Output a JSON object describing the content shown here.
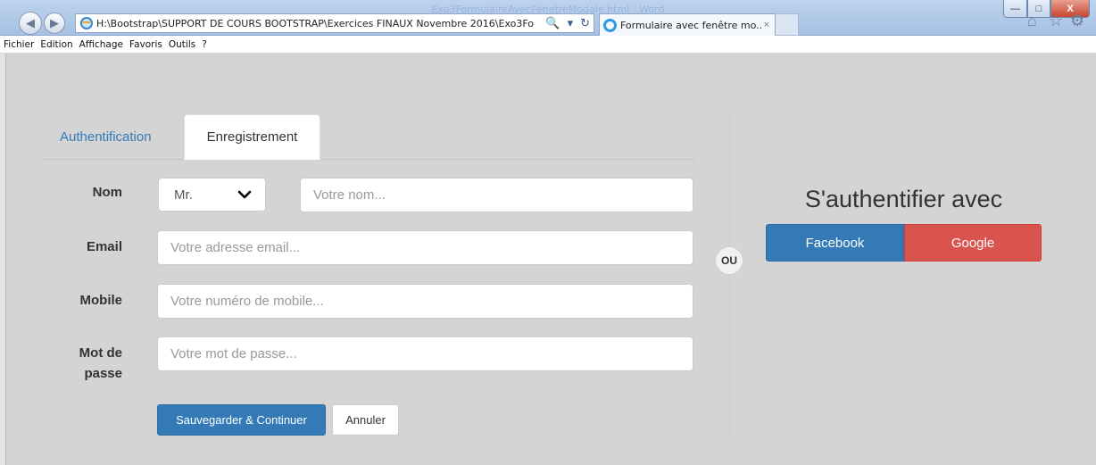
{
  "browser": {
    "window_title": "Exo3FormulaireAvecFenetreModale.html - Word",
    "url": "H:\\Bootstrap\\SUPPORT DE COURS BOOTSTRAP\\Exercices FINAUX Novembre 2016\\Exo3Fo",
    "search_icon": "🔍",
    "dropdown_arrow": "▾",
    "refresh_icon": "↻",
    "tab_title": "Formulaire avec fenêtre mo...",
    "tab_close": "×",
    "back": "◀",
    "forward": "▶",
    "home": "⌂",
    "favorites": "☆",
    "tools": "⚙",
    "min": "—",
    "max": "□",
    "close": "X",
    "menu": [
      "Fichier",
      "Edition",
      "Affichage",
      "Favoris",
      "Outils",
      "?"
    ]
  },
  "tabs": {
    "authentication": "Authentification",
    "registration": "Enregistrement"
  },
  "form": {
    "name_label": "Nom",
    "title_selected": "Mr.",
    "name_placeholder": "Votre nom...",
    "email_label": "Email",
    "email_placeholder": "Votre adresse email...",
    "mobile_label": "Mobile",
    "mobile_placeholder": "Votre numéro de mobile...",
    "password_label_line1": "Mot de",
    "password_label_line2": "passe",
    "password_placeholder": "Votre mot de passe...",
    "save_button": "Sauvegarder & Continuer",
    "cancel_button": "Annuler"
  },
  "separator": {
    "or": "OU"
  },
  "social": {
    "title": "S'authentifier avec",
    "facebook": "Facebook",
    "google": "Google"
  },
  "colors": {
    "primary": "#337ab7",
    "danger": "#d9534f",
    "background": "#d4d4d4"
  },
  "icons": [
    "back-icon",
    "forward-icon",
    "page-icon",
    "search-icon",
    "refresh-icon",
    "ie-icon",
    "home-icon",
    "favorites-icon",
    "gear-icon",
    "chevron-down-icon"
  ]
}
